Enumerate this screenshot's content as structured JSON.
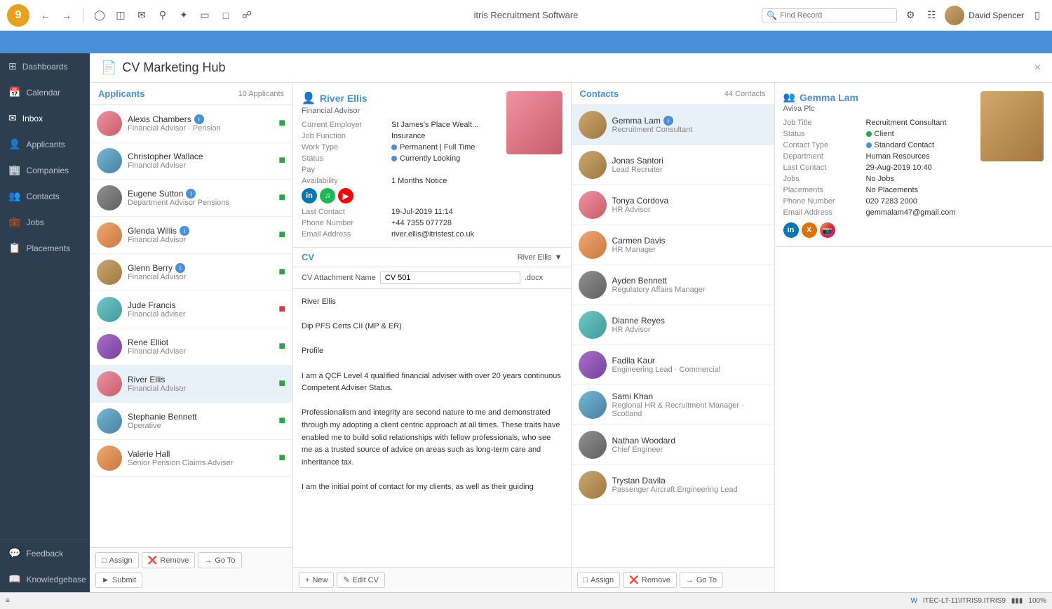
{
  "app": {
    "title": "itris Recruitment Software",
    "icon_label": "9"
  },
  "topbar": {
    "search_placeholder": "Find Record",
    "user_name": "David Spencer"
  },
  "page": {
    "title": "CV Marketing Hub",
    "close_label": "×"
  },
  "sidebar": {
    "items": [
      {
        "id": "dashboards",
        "label": "Dashboards",
        "icon": "⊞"
      },
      {
        "id": "calendar",
        "label": "Calendar",
        "icon": "📅"
      },
      {
        "id": "inbox",
        "label": "Inbox",
        "icon": "✉"
      },
      {
        "id": "applicants",
        "label": "Applicants",
        "icon": "👤"
      },
      {
        "id": "companies",
        "label": "Companies",
        "icon": "🏢"
      },
      {
        "id": "contacts",
        "label": "Contacts",
        "icon": "👥"
      },
      {
        "id": "jobs",
        "label": "Jobs",
        "icon": "💼"
      },
      {
        "id": "placements",
        "label": "Placements",
        "icon": "📋"
      }
    ],
    "bottom_items": [
      {
        "id": "feedback",
        "label": "Feedback",
        "icon": "💬"
      },
      {
        "id": "knowledgebase",
        "label": "Knowledgebase",
        "icon": "📖"
      }
    ]
  },
  "applicants": {
    "title": "Applicants",
    "count": "10 Applicants",
    "list": [
      {
        "name": "Alexis Chambers",
        "role": "Financial Advisor · Pension",
        "has_info": true,
        "doc_color": "green",
        "avatar_class": "av-pink"
      },
      {
        "name": "Christopher Wallace",
        "role": "Financial Adviser",
        "has_info": false,
        "doc_color": "green",
        "avatar_class": "av-blue"
      },
      {
        "name": "Eugene Sutton",
        "role": "Department Advisor Pensions",
        "has_info": true,
        "doc_color": "green",
        "avatar_class": "av-gray"
      },
      {
        "name": "Glenda Willis",
        "role": "Financial Advisor",
        "has_info": true,
        "doc_color": "green",
        "avatar_class": "av-orange"
      },
      {
        "name": "Glenn Berry",
        "role": "Financial Advisor",
        "has_info": true,
        "doc_color": "green",
        "avatar_class": "av-brown"
      },
      {
        "name": "Jude Francis",
        "role": "Financial adviser",
        "has_info": false,
        "doc_color": "red",
        "avatar_class": "av-teal"
      },
      {
        "name": "Rene Elliot",
        "role": "Financial Adviser",
        "has_info": false,
        "doc_color": "green",
        "avatar_class": "av-purple"
      },
      {
        "name": "River Ellis",
        "role": "Financial Advisor",
        "has_info": false,
        "doc_color": "green",
        "avatar_class": "av-pink",
        "selected": true
      },
      {
        "name": "Stephanie Bennett",
        "role": "Operative",
        "has_info": false,
        "doc_color": "green",
        "avatar_class": "av-blue"
      },
      {
        "name": "Valerie Hall",
        "role": "Senior Pension Claims Adviser",
        "has_info": false,
        "doc_color": "green",
        "avatar_class": "av-orange"
      }
    ],
    "footer": {
      "assign": "Assign",
      "remove": "Remove",
      "goto": "Go To",
      "submit": "Submit"
    }
  },
  "cv": {
    "applicant": {
      "name": "River Ellis",
      "role": "Financial Advisor",
      "current_employer_label": "Current Employer",
      "current_employer": "St James's Place Wealt...",
      "job_function_label": "Job Function",
      "job_function": "Insurance",
      "work_type_label": "Work Type",
      "work_type": "Permanent | Full Time",
      "status_label": "Status",
      "status": "Currently Looking",
      "pay_label": "Pay",
      "pay": "",
      "availability_label": "Availability",
      "availability": "1 Months Notice",
      "last_contact_label": "Last Contact",
      "last_contact": "19-Jul-2019 11:14",
      "phone_label": "Phone Number",
      "phone": "+44 7355 077728",
      "email_label": "Email Address",
      "email": "river.ellis@itristest.co.uk"
    },
    "section_title": "CV",
    "owner": "River Ellis",
    "attachment_label": "CV Attachment Name",
    "attachment_value": "CV 501",
    "attachment_ext": ".docx",
    "text": "River Ellis\n\nDip PFS Certs CII (MP & ER)\n\nProfile\n\nI am a QCF Level 4 qualified financial adviser with over 20 years continuous Competent Adviser Status.\n\nProfessionalism and integrity are second nature to me and demonstrated through my adopting a client centric approach at all times. These traits have enabled me to build solid relationships with fellow professionals, who see me as a trusted source of advice on areas such as long-term care and inheritance tax.\n\nI am the initial point of contact for my clients, as well as their guiding",
    "footer": {
      "new": "New",
      "edit_cv": "Edit CV"
    }
  },
  "contacts": {
    "title": "Contacts",
    "count": "44 Contacts",
    "list": [
      {
        "name": "Gemma Lam",
        "role": "Recruitment Consultant",
        "has_info": true,
        "avatar_class": "av-brown",
        "selected": true
      },
      {
        "name": "Jonas Santori",
        "role": "Lead Recruiter",
        "has_info": false,
        "avatar_class": "av-brown"
      },
      {
        "name": "Tonya Cordova",
        "role": "HR Advisor",
        "has_info": false,
        "avatar_class": "av-pink"
      },
      {
        "name": "Carmen Davis",
        "role": "HR Manager",
        "has_info": false,
        "avatar_class": "av-orange"
      },
      {
        "name": "Ayden Bennett",
        "role": "Regulatory Affairs Manager",
        "has_info": false,
        "avatar_class": "av-gray"
      },
      {
        "name": "Dianne Reyes",
        "role": "HR Advisor",
        "has_info": false,
        "avatar_class": "av-teal"
      },
      {
        "name": "Fadila Kaur",
        "role": "Engineering Lead · Commercial",
        "has_info": false,
        "avatar_class": "av-purple"
      },
      {
        "name": "Sami Khan",
        "role": "Regional HR & Recruitment Manager · Scotland",
        "has_info": false,
        "avatar_class": "av-blue"
      },
      {
        "name": "Nathan Woodard",
        "role": "Chief Engineer",
        "has_info": false,
        "avatar_class": "av-gray"
      },
      {
        "name": "Trystan Davila",
        "role": "Passenger Aircraft Engineering Lead",
        "has_info": false,
        "avatar_class": "av-brown"
      }
    ],
    "footer": {
      "assign": "Assign",
      "remove": "Remove",
      "goto": "Go To"
    }
  },
  "contact_detail": {
    "name": "Gemma Lam",
    "company": "Aviva Plc",
    "job_title_label": "Job Title",
    "job_title": "Recruitment Consultant",
    "status_label": "Status",
    "status": "Client",
    "contact_type_label": "Contact Type",
    "contact_type": "Standard Contact",
    "department_label": "Department",
    "department": "Human Resources",
    "last_contact_label": "Last Contact",
    "last_contact": "29-Aug-2019 10:40",
    "jobs_label": "Jobs",
    "jobs": "No Jobs",
    "placements_label": "Placements",
    "placements": "No Placements",
    "phone_label": "Phone Number",
    "phone": "020 7283 2000",
    "email_label": "Email Address",
    "email": "gemmalam47@gmail.com"
  },
  "statusbar": {
    "left": "≡",
    "itec": "ITEC-LT-11\\ITRIS9.ITRIS9",
    "zoom": "100%"
  }
}
